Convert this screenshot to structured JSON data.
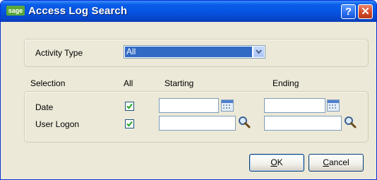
{
  "window": {
    "title": "Access Log Search",
    "logo_text": "sage",
    "help_symbol": "?",
    "close_symbol": "✕"
  },
  "activity": {
    "label": "Activity Type",
    "selected": "All"
  },
  "selection": {
    "headers": {
      "selection": "Selection",
      "all": "All",
      "starting": "Starting",
      "ending": "Ending"
    },
    "rows": [
      {
        "label": "Date",
        "all_checked": true,
        "starting": "",
        "ending": "",
        "lookup_icon": "calendar-icon"
      },
      {
        "label": "User Logon",
        "all_checked": true,
        "starting": "",
        "ending": "",
        "lookup_icon": "search-icon"
      }
    ]
  },
  "buttons": {
    "ok": {
      "mnemonic": "O",
      "rest": "K"
    },
    "cancel": {
      "mnemonic": "C",
      "rest": "ancel"
    }
  },
  "colors": {
    "title_bar": "#0553e1",
    "selection_highlight": "#316ac5",
    "dialog_bg": "#ece9d8"
  }
}
